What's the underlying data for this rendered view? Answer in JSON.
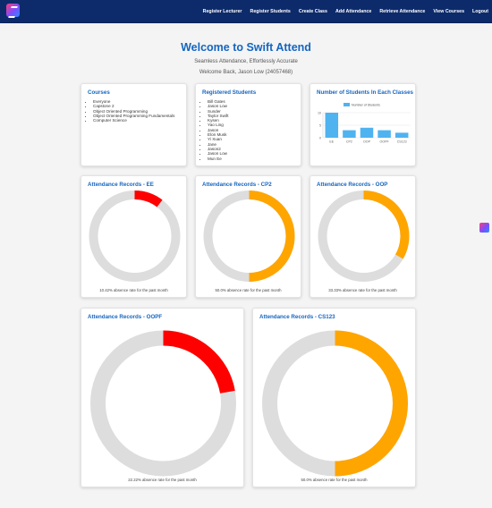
{
  "nav": {
    "links": [
      "Register Lecturer",
      "Register Students",
      "Create Class",
      "Add Attendance",
      "Retrieve Attendance",
      "View Courses",
      "Logout"
    ]
  },
  "hero": {
    "title": "Welcome to Swift Attend",
    "tagline": "Seamless Attendance, Effortlessly Accurate",
    "welcome": "Welcome Back, Jason Low (24057468)"
  },
  "courses": {
    "title": "Courses",
    "items": [
      "Everyone",
      "Capstone 2",
      "Object Oriented Programming",
      "Object Oriented Programming Fundamentals",
      "Computer Science"
    ]
  },
  "students": {
    "title": "Registered Students",
    "items": [
      "Bill Gates",
      "Jason Low",
      "Sunder",
      "Taylor Swift",
      "Kysen",
      "Yao Ling",
      "Jason",
      "Elon Musk",
      "Yi Xuan",
      "Jane",
      "Jason2",
      "Jason Low",
      "Mun Ee"
    ]
  },
  "colors": {
    "brand": "#1565c0",
    "nav": "#0d2b6b",
    "bar": "#4fb3f0",
    "red": "#ff0000",
    "orange": "#ffa500",
    "ring": "#dddddd"
  },
  "chart_data": [
    {
      "type": "bar",
      "title": "Number of Students In Each Classes",
      "legend": "Number of Students",
      "legend_position": "top",
      "categories": [
        "EE",
        "CP2",
        "OOP",
        "OOPF",
        "CS123"
      ],
      "series": [
        {
          "name": "Number of Students",
          "values": [
            10,
            3,
            4,
            3,
            2
          ]
        }
      ],
      "ylim": [
        0,
        10
      ],
      "yticks": [
        "0",
        "5",
        "10"
      ],
      "grid": true
    },
    {
      "type": "pie",
      "title": "Attendance Records - EE",
      "absence_pct": 10.42,
      "caption": "10.42% absence rate for the past month",
      "color": "red"
    },
    {
      "type": "pie",
      "title": "Attendance Records - CP2",
      "absence_pct": 50.0,
      "caption": "50.0% absence rate for the past month",
      "color": "orange"
    },
    {
      "type": "pie",
      "title": "Attendance Records - OOP",
      "absence_pct": 33.33,
      "caption": "33.33% absence rate for the past month",
      "color": "orange"
    },
    {
      "type": "pie",
      "title": "Attendance Records - OOPF",
      "absence_pct": 22.22,
      "caption": "22.22% absence rate for the past month",
      "color": "red"
    },
    {
      "type": "pie",
      "title": "Attendance Records - CS123",
      "absence_pct": 50.0,
      "caption": "50.0% absence rate for the past month",
      "color": "orange"
    }
  ]
}
